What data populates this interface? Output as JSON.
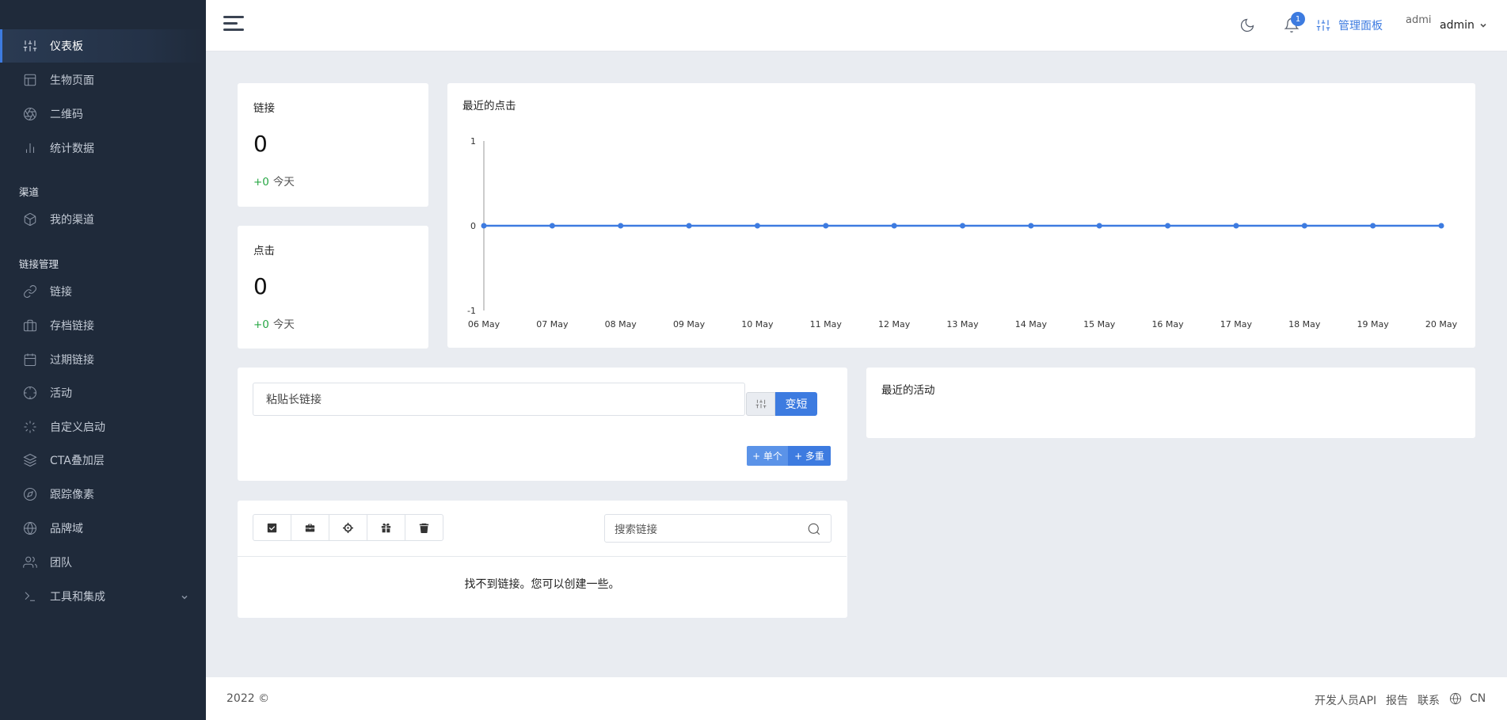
{
  "sidebar": {
    "items": [
      {
        "label": "仪表板",
        "icon": "sliders-icon"
      },
      {
        "label": "生物页面",
        "icon": "layout-icon"
      },
      {
        "label": "二维码",
        "icon": "aperture-icon"
      },
      {
        "label": "统计数据",
        "icon": "bar-chart-icon"
      },
      {
        "label": "我的渠道",
        "icon": "box-icon"
      },
      {
        "label": "链接",
        "icon": "link-icon"
      },
      {
        "label": "存档链接",
        "icon": "briefcase-icon"
      },
      {
        "label": "过期链接",
        "icon": "calendar-icon"
      },
      {
        "label": "活动",
        "icon": "crosshair-icon"
      },
      {
        "label": "自定义启动",
        "icon": "loader-icon"
      },
      {
        "label": "CTA叠加层",
        "icon": "layers-icon"
      },
      {
        "label": "跟踪像素",
        "icon": "compass-icon"
      },
      {
        "label": "品牌域",
        "icon": "globe-icon"
      },
      {
        "label": "团队",
        "icon": "users-icon"
      },
      {
        "label": "工具和集成",
        "icon": "terminal-icon"
      }
    ],
    "sections": {
      "channels": "渠道",
      "link_mgmt": "链接管理"
    }
  },
  "topbar": {
    "notification_count": "1",
    "admin_panel": "管理面板",
    "user_short": "admi",
    "user_name": "admin"
  },
  "stats": {
    "links": {
      "title": "链接",
      "value": "0",
      "delta": "+0",
      "delta_label": "今天"
    },
    "clicks": {
      "title": "点击",
      "value": "0",
      "delta": "+0",
      "delta_label": "今天"
    }
  },
  "recent_clicks": {
    "title": "最近的点击"
  },
  "chart_data": {
    "type": "line",
    "title": "最近的点击",
    "x": [
      "06 May",
      "07 May",
      "08 May",
      "09 May",
      "10 May",
      "11 May",
      "12 May",
      "13 May",
      "14 May",
      "15 May",
      "16 May",
      "17 May",
      "18 May",
      "19 May",
      "20 May"
    ],
    "values": [
      0,
      0,
      0,
      0,
      0,
      0,
      0,
      0,
      0,
      0,
      0,
      0,
      0,
      0,
      0
    ],
    "yticks": [
      "1",
      "0",
      "-1"
    ],
    "ylim": [
      -1,
      1
    ],
    "grid": false,
    "color": "#3d7be0"
  },
  "shorten": {
    "placeholder": "粘贴长链接",
    "shorten_label": "变短",
    "single_label": "+ 单个",
    "multi_label": "+ 多重"
  },
  "recent_activity": {
    "title": "最近的活动"
  },
  "links_list": {
    "search_placeholder": "搜索链接",
    "empty_message": "找不到链接。您可以创建一些。",
    "tools": [
      "check-square-icon",
      "briefcase-icon",
      "crosshair-icon",
      "gift-icon",
      "trash-icon"
    ]
  },
  "footer": {
    "copyright": "2022 ©",
    "developer_api": "开发人员API",
    "report": "报告",
    "contact": "联系",
    "language": "CN"
  }
}
